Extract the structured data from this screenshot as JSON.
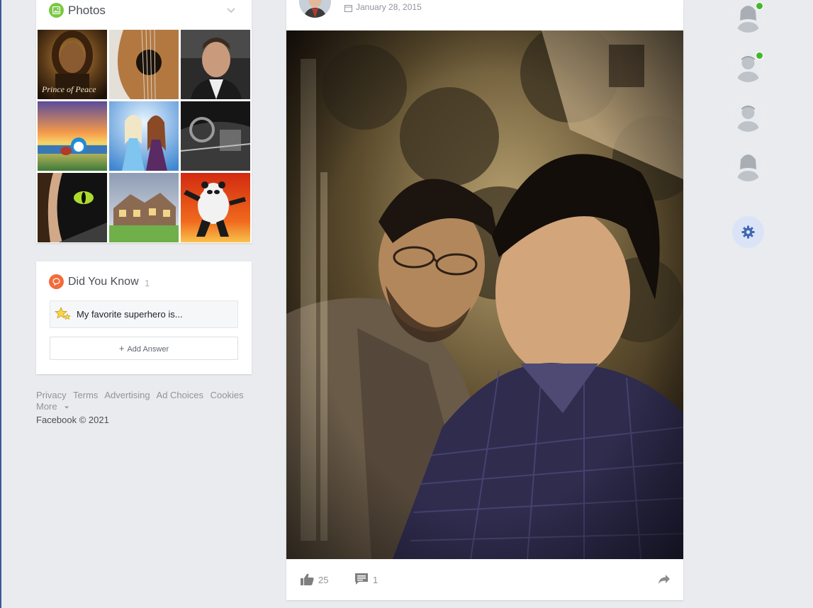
{
  "photos": {
    "title": "Photos",
    "icon": "photo-icon",
    "items": [
      {
        "name": "prince-of-peace",
        "caption": "Prince of Peace",
        "colors": [
          "#6b4a22",
          "#2a1a0c"
        ]
      },
      {
        "name": "guitar",
        "colors": [
          "#b0763d",
          "#e6e1da"
        ]
      },
      {
        "name": "man-portrait",
        "colors": [
          "#2e2e2e",
          "#c59a7b"
        ]
      },
      {
        "name": "doraemon-sunset",
        "colors": [
          "#f3a24b",
          "#4d4d8e"
        ]
      },
      {
        "name": "frozen",
        "colors": [
          "#4b8fd6",
          "#d4e8fa"
        ]
      },
      {
        "name": "car-interior",
        "colors": [
          "#1c1c1c",
          "#8a8a8a"
        ]
      },
      {
        "name": "dragon-eye",
        "colors": [
          "#1f1f1f",
          "#c8a58a"
        ]
      },
      {
        "name": "house",
        "colors": [
          "#b0b8c6",
          "#6fae4d"
        ]
      },
      {
        "name": "kung-fu-panda",
        "colors": [
          "#e14a17",
          "#f7c24a"
        ]
      }
    ]
  },
  "did_you_know": {
    "title": "Did You Know",
    "count": "1",
    "question": "My favorite superhero is...",
    "add_answer": "Add Answer"
  },
  "footer": {
    "links": [
      "Privacy",
      "Terms",
      "Advertising",
      "Ad Choices",
      "Cookies"
    ],
    "more": "More",
    "copyright": "Facebook © 2021"
  },
  "post": {
    "date": "January 28, 2015",
    "likes": "25",
    "comments": "1"
  },
  "right_rail": {
    "friends": [
      {
        "name": "friend-1",
        "online": true
      },
      {
        "name": "friend-2",
        "online": true
      },
      {
        "name": "friend-3",
        "online": false
      },
      {
        "name": "friend-4",
        "online": false
      }
    ],
    "settings_icon": "gear-icon"
  },
  "colors": {
    "background": "#e9ebee",
    "photos_icon": "#7ac943",
    "did_you_know_icon": "#f26b3a",
    "online": "#42b72a",
    "settings_bg": "#dbe4f6",
    "settings_icon": "#4267b2"
  }
}
